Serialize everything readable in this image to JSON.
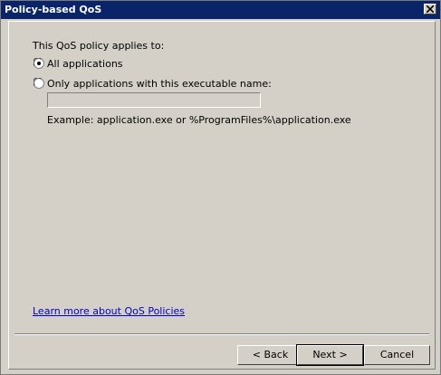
{
  "window": {
    "title": "Policy-based QoS"
  },
  "policy": {
    "heading": "This QoS policy applies to:",
    "option_all": "All applications",
    "option_exe": "Only applications with this executable name:",
    "exe_value": "",
    "selected": "all",
    "example": "Example:  application.exe or %ProgramFiles%\\application.exe"
  },
  "footer": {
    "learn_link": "Learn more about QoS Policies",
    "back_label": "< Back",
    "next_label": "Next >",
    "cancel_label": "Cancel"
  },
  "colors": {
    "titlebar": "#0a246a",
    "dialog_bg": "#d4d0c8",
    "link": "#0000cc"
  }
}
